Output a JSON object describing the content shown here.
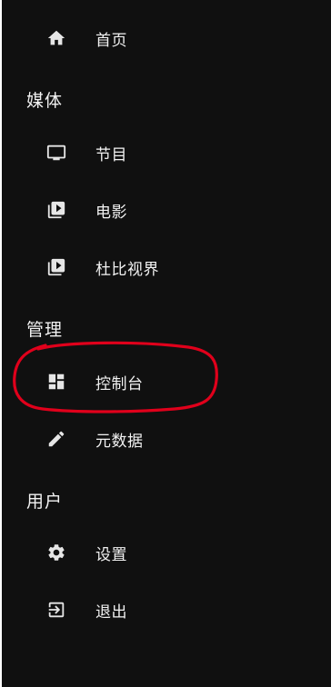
{
  "nav": {
    "home": {
      "label": "首页",
      "icon": "home-icon"
    },
    "sections": {
      "media": "媒体",
      "admin": "管理",
      "user": "用户"
    },
    "media_items": [
      {
        "label": "节目",
        "icon": "tv-icon"
      },
      {
        "label": "电影",
        "icon": "video-library-icon"
      },
      {
        "label": "杜比视界",
        "icon": "video-library-icon"
      }
    ],
    "admin_items": [
      {
        "label": "控制台",
        "icon": "dashboard-icon",
        "highlighted": true
      },
      {
        "label": "元数据",
        "icon": "edit-pencil-icon"
      }
    ],
    "user_items": [
      {
        "label": "设置",
        "icon": "gear-icon"
      },
      {
        "label": "退出",
        "icon": "logout-icon"
      }
    ]
  },
  "colors": {
    "background": "#101010",
    "text": "#f2f2f2",
    "highlight_stroke": "#e0001b"
  }
}
